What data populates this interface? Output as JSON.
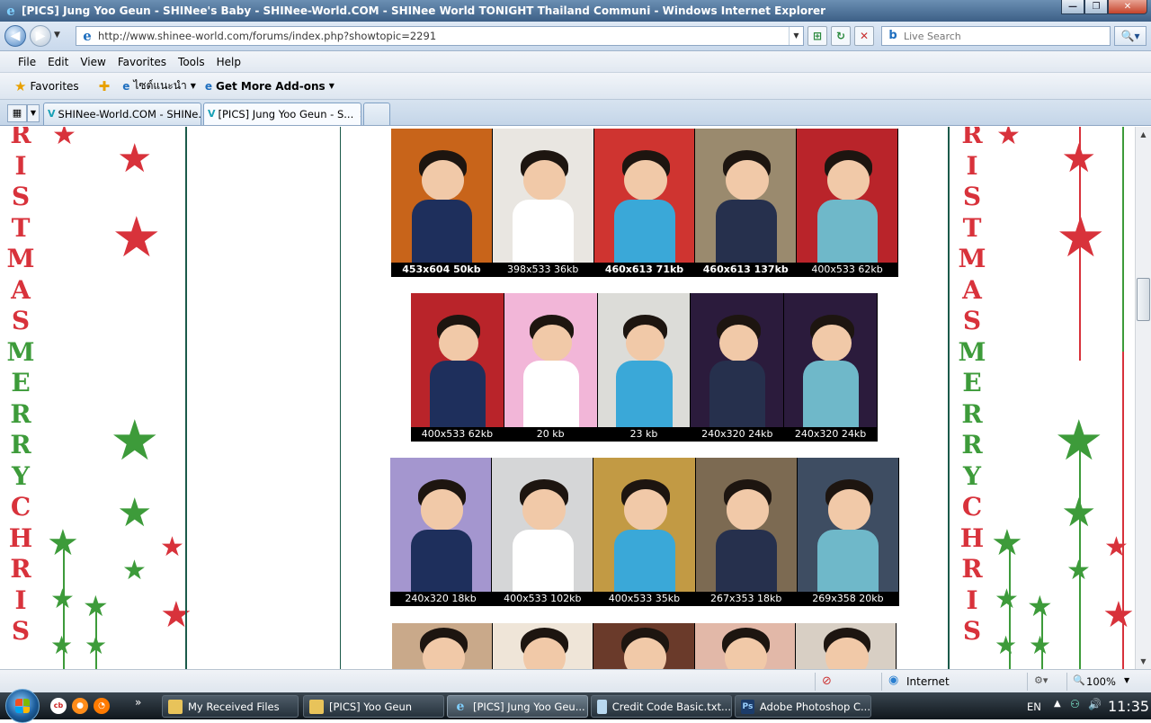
{
  "window": {
    "title": "[PICS] Jung Yoo Geun - SHINee's Baby - SHINee-World.COM - SHINee World TONIGHT Thailand Communi - Windows Internet Explorer",
    "minimize": "—",
    "maximize": "❐",
    "close": "✕"
  },
  "address_bar": {
    "url": "http://www.shinee-world.com/forums/index.php?showtopic=2291",
    "search_placeholder": "Live Search"
  },
  "menu": [
    "File",
    "Edit",
    "View",
    "Favorites",
    "Tools",
    "Help"
  ],
  "favorites_bar": {
    "favorites_label": "Favorites",
    "suggested_sites": "ไซต์แนะนำ",
    "get_addons": "Get More Add-ons"
  },
  "tabs": [
    {
      "label": "SHINee-World.COM - SHINe..."
    },
    {
      "label": "[PICS] Jung Yoo Geun - S..."
    }
  ],
  "banner_letters_left": [
    "R",
    "I",
    "S",
    "T",
    "M",
    "A",
    "S",
    "M",
    "E",
    "R",
    "R",
    "Y",
    "C",
    "H",
    "R",
    "I",
    "S"
  ],
  "banner_letters_right": [
    "R",
    "I",
    "S",
    "T",
    "M",
    "A",
    "S",
    "M",
    "E",
    "R",
    "R",
    "Y",
    "C",
    "H",
    "R",
    "I",
    "S"
  ],
  "photo_rows": [
    {
      "photos": [
        {
          "caption": "453x604 50kb",
          "bold": true,
          "bg": "#c8641a"
        },
        {
          "caption": "398x533 36kb",
          "bold": false,
          "bg": "#e9e6e1"
        },
        {
          "caption": "460x613 71kb",
          "bold": true,
          "bg": "#cf3430"
        },
        {
          "caption": "460x613 137kb",
          "bold": true,
          "bg": "#9a8a6e"
        },
        {
          "caption": "400x533 62kb",
          "bold": false,
          "bg": "#b9242a"
        }
      ]
    },
    {
      "photos": [
        {
          "caption": "400x533 62kb",
          "bg": "#b9242a"
        },
        {
          "caption": "20 kb",
          "bg": "#f2b6d8"
        },
        {
          "caption": "23 kb",
          "bg": "#dcdcd8"
        },
        {
          "caption": "240x320 24kb",
          "bg": "#2b1b3c"
        },
        {
          "caption": "240x320 24kb",
          "bg": "#2b1b3c"
        }
      ]
    },
    {
      "photos": [
        {
          "caption": "240x320 18kb",
          "bg": "#a496cf"
        },
        {
          "caption": "400x533 102kb",
          "bg": "#d5d6d7"
        },
        {
          "caption": "400x533 35kb",
          "bg": "#c29a44"
        },
        {
          "caption": "267x353 18kb",
          "bg": "#7c6a52"
        },
        {
          "caption": "269x358 20kb",
          "bg": "#3e4d62"
        }
      ]
    },
    {
      "photos": [
        {
          "caption": "",
          "bg": "#c9a98a"
        },
        {
          "caption": "",
          "bg": "#efe5d8"
        },
        {
          "caption": "",
          "bg": "#6a3a2a"
        },
        {
          "caption": "",
          "bg": "#e2b8a8"
        },
        {
          "caption": "",
          "bg": "#d8cfc4"
        }
      ]
    }
  ],
  "status_bar": {
    "zone": "Internet",
    "zoom": "100%"
  },
  "taskbar": {
    "items": [
      {
        "label": "My Received Files",
        "icon": "folder-icon"
      },
      {
        "label": "[PICS] Yoo Geun",
        "icon": "folder-icon"
      },
      {
        "label": "[PICS] Jung Yoo Geu...",
        "icon": "ie-icon"
      },
      {
        "label": "Credit Code Basic.txt...",
        "icon": "notepad-icon"
      },
      {
        "label": "Adobe Photoshop C...",
        "icon": "photoshop-icon"
      }
    ],
    "language": "EN",
    "clock": "11:35"
  },
  "colors": {
    "banner_red": "#d8323b",
    "banner_green": "#3d9b3a",
    "frame_green": "#1b5a4a"
  }
}
